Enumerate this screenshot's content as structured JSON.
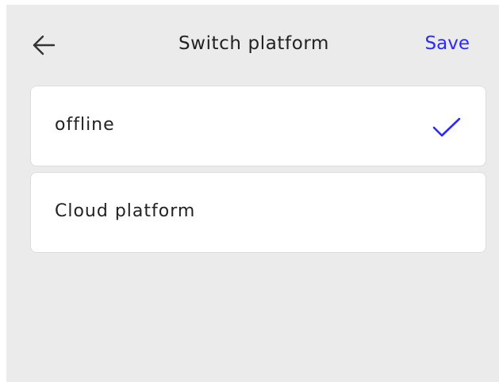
{
  "header": {
    "back_icon": "arrow-left-icon",
    "title": "Switch platform",
    "save_label": "Save",
    "save_color": "#2a2aff"
  },
  "platforms": [
    {
      "label": "offline",
      "selected": true,
      "check_icon": "checkmark-icon"
    },
    {
      "label": "Cloud platform",
      "selected": false
    }
  ],
  "colors": {
    "background": "#ebebeb",
    "card": "#ffffff",
    "check": "#2a2aff"
  }
}
